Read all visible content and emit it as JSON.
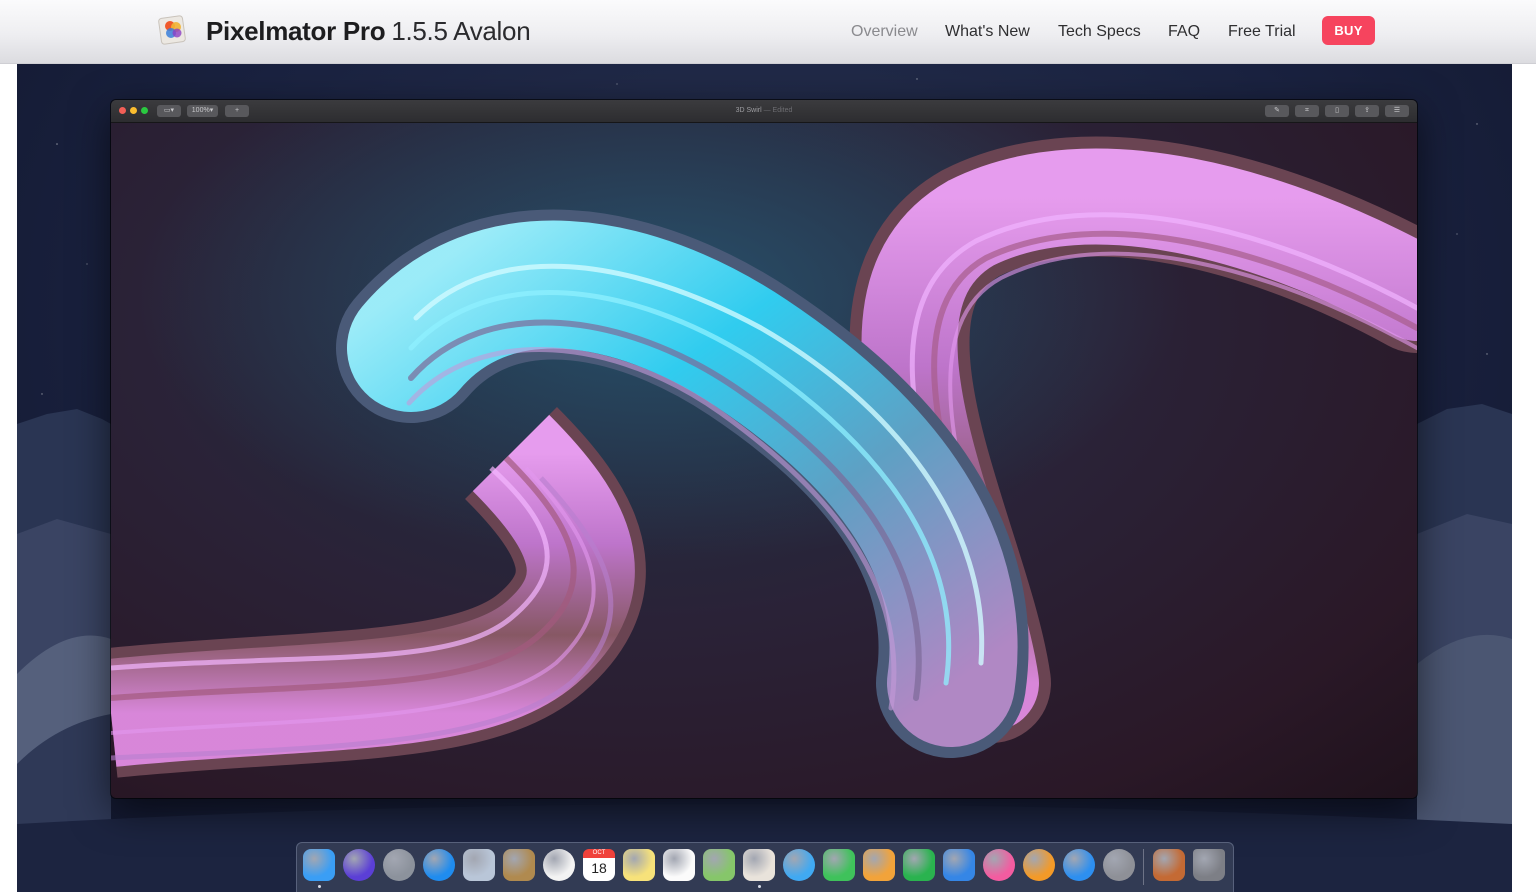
{
  "header": {
    "app_name": "Pixelmator Pro",
    "version": "1.5.5 Avalon",
    "nav": [
      {
        "label": "Overview",
        "active": true
      },
      {
        "label": "What's New",
        "active": false
      },
      {
        "label": "Tech Specs",
        "active": false
      },
      {
        "label": "FAQ",
        "active": false
      },
      {
        "label": "Free Trial",
        "active": false
      }
    ],
    "buy_label": "BUY",
    "buy_color": "#f6445e"
  },
  "app_window": {
    "document_title": "3D Swirl",
    "document_state": "— Edited",
    "zoom": "100%",
    "add_label": "+"
  },
  "dock": {
    "apps": [
      {
        "icon": "finder-icon",
        "color": "#3a9ef5",
        "running": true
      },
      {
        "icon": "siri-icon",
        "color": "#5b3fd6",
        "running": false
      },
      {
        "icon": "launchpad-icon",
        "color": "#8c929c",
        "running": false
      },
      {
        "icon": "safari-icon",
        "color": "#1f8cef",
        "running": false
      },
      {
        "icon": "mail-icon",
        "color": "#b9c6d8",
        "running": false
      },
      {
        "icon": "contacts-icon",
        "color": "#b08a4f",
        "running": false
      },
      {
        "icon": "photos-icon",
        "color": "#f3f3f3",
        "running": false
      },
      {
        "icon": "calendar-icon",
        "color": "#ffffff",
        "running": false
      },
      {
        "icon": "notes-icon",
        "color": "#f7e27a",
        "running": false
      },
      {
        "icon": "reminders-icon",
        "color": "#fbfbfb",
        "running": false
      },
      {
        "icon": "maps-icon",
        "color": "#86c66a",
        "running": false
      },
      {
        "icon": "pixelmator-pro-icon",
        "color": "#e9e3db",
        "running": true
      },
      {
        "icon": "messages-icon",
        "color": "#40a9f2",
        "running": false
      },
      {
        "icon": "facetime-icon",
        "color": "#3fc25b",
        "running": false
      },
      {
        "icon": "pages-icon",
        "color": "#f2a33a",
        "running": false
      },
      {
        "icon": "numbers-icon",
        "color": "#2ab34f",
        "running": false
      },
      {
        "icon": "keynote-icon",
        "color": "#3586e6",
        "running": false
      },
      {
        "icon": "itunes-icon",
        "color": "#f35ca0",
        "running": false
      },
      {
        "icon": "ibooks-icon",
        "color": "#f39a28",
        "running": false
      },
      {
        "icon": "app-store-icon",
        "color": "#2d8ff0",
        "running": false
      },
      {
        "icon": "system-preferences-icon",
        "color": "#8e9097",
        "running": false
      }
    ],
    "extras": [
      {
        "icon": "downloads-stack-icon",
        "color": "#c46a34"
      },
      {
        "icon": "trash-icon",
        "color": "#7d7f86"
      }
    ],
    "calendar": {
      "month": "OCT",
      "day": "18"
    }
  }
}
